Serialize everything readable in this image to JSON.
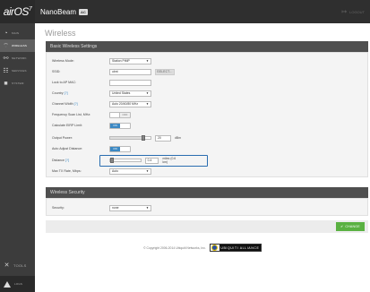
{
  "brand": {
    "logo_text": "airOS",
    "logo_sup": "7"
  },
  "header": {
    "device_name": "NanoBeam",
    "device_badge": "AC",
    "logout_label": "LOGOUT"
  },
  "sidebar": {
    "items": [
      {
        "label": "MAIN",
        "icon": "dashboard-icon"
      },
      {
        "label": "WIRELESS",
        "icon": "wireless-icon"
      },
      {
        "label": "NETWORK",
        "icon": "network-icon"
      },
      {
        "label": "SERVICES",
        "icon": "services-icon"
      },
      {
        "label": "SYSTEM",
        "icon": "system-icon"
      }
    ],
    "tools_label": "TOOLS",
    "alert_label": "LOGS"
  },
  "page": {
    "title": "Wireless"
  },
  "basic": {
    "section_title": "Basic Wireless Settings",
    "wireless_mode": {
      "label": "Wireless Mode:",
      "value": "Station PtMP"
    },
    "ssid": {
      "label": "SSID:",
      "value": "ubnt",
      "button": "SELECT..."
    },
    "lock_ap": {
      "label": "Lock to AP MAC:",
      "value": ""
    },
    "country": {
      "label": "Country",
      "hint": "[?]",
      "value": "United States"
    },
    "channel_width": {
      "label": "Channel Width",
      "hint": "[?]",
      "value": "Auto 20/40/80 MHz"
    },
    "freq_scan": {
      "label": "Frequency Scan List, MHz:",
      "toggle": "OFF"
    },
    "calc_eirp": {
      "label": "Calculate EIRP Limit:",
      "toggle": "ON"
    },
    "output_power": {
      "label": "Output Power:",
      "value": "20",
      "unit": "dBm",
      "level_pct": 82
    },
    "auto_distance": {
      "label": "Auto Adjust Distance:",
      "toggle": "ON"
    },
    "distance": {
      "label": "Distance",
      "hint": "[?]",
      "value": "0.4",
      "unit": "miles (0.6 km)",
      "level_pct": 3
    },
    "max_tx": {
      "label": "Max TX Rate, Mbps:",
      "value": "Auto"
    }
  },
  "security": {
    "section_title": "Wireless Security",
    "label": "Security:",
    "value": "none"
  },
  "actions": {
    "change_label": "CHANGE"
  },
  "footer": {
    "copyright": "© Copyright 2006-2014 Ubiquiti Networks, Inc.",
    "logo_band": "UBIQUITI ALLIANCE"
  },
  "colors": {
    "accent": "#3b88c3",
    "highlight": "#2a6db0",
    "change": "#5ab142"
  }
}
